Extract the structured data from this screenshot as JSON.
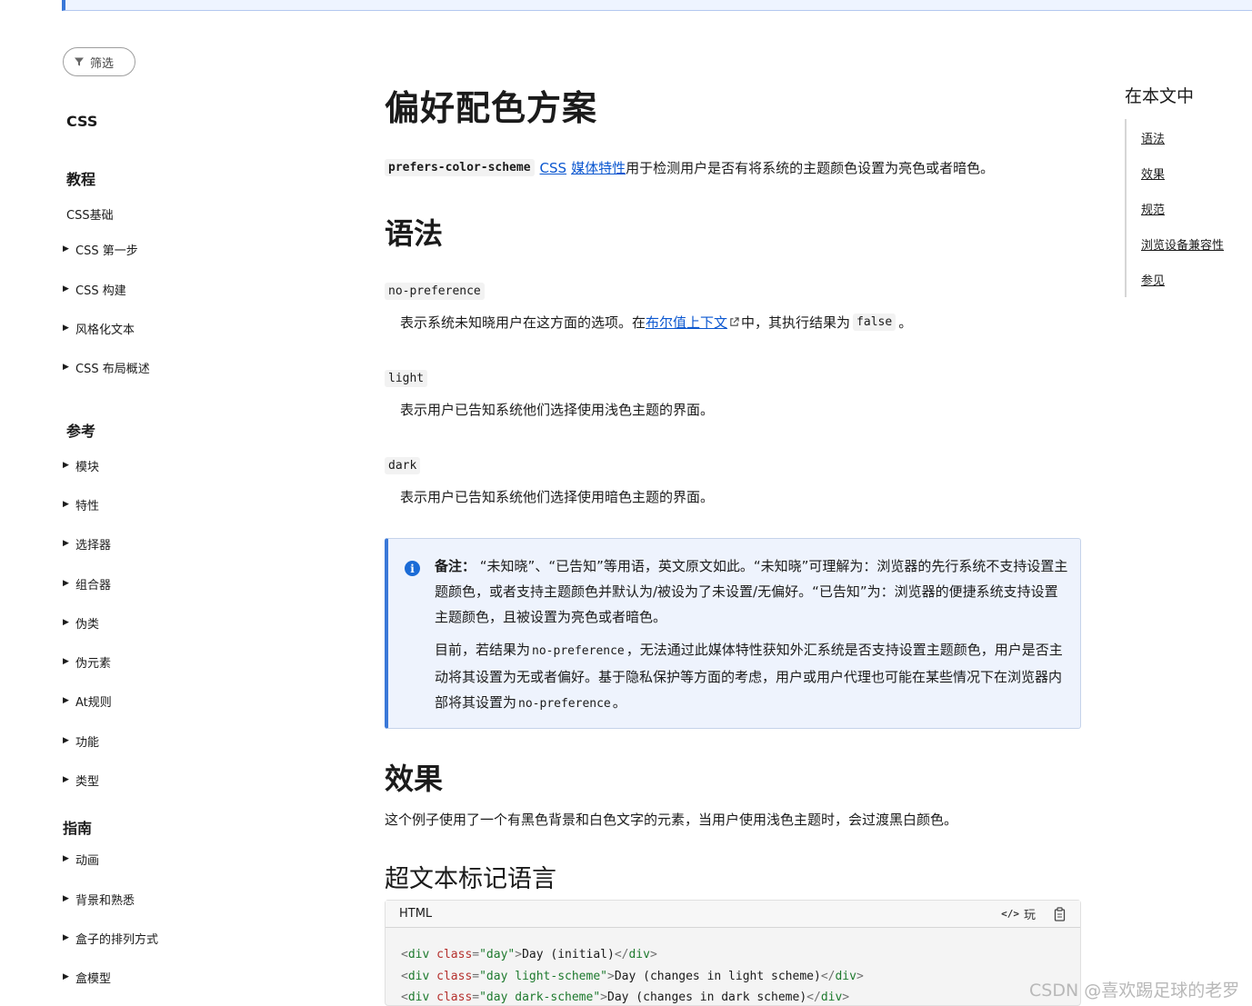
{
  "sidebar": {
    "filter_label": "筛选",
    "css_heading": "CSS",
    "tutorial_heading": "教程",
    "tutorial_basics": "CSS基础",
    "tutorial_items": [
      "CSS 第一步",
      "CSS 构建",
      "风格化文本",
      "CSS 布局概述"
    ],
    "reference_heading": "参考",
    "reference_items": [
      "模块",
      "特性",
      "选择器",
      "组合器",
      "伪类",
      "伪元素",
      "At规则",
      "功能",
      "类型"
    ],
    "guide_heading": "指南",
    "guide_items": [
      "动画",
      "背景和熟悉",
      "盒子的排列方式",
      "盒模型"
    ]
  },
  "article": {
    "title": "偏好配色方案",
    "intro": {
      "code": "prefers-color-scheme",
      "link1": "CSS",
      "link2": "媒体特性",
      "text": "用于检测用户是否有将系统的主题颜色设置为亮色或者暗色。"
    },
    "syntax_heading": "语法",
    "values": [
      {
        "term": "no-preference",
        "desc_before": "表示系统未知晓用户在这方面的选项。在",
        "link": "布尔值上下文",
        "desc_after": "中，其执行结果为",
        "code": "false",
        "end": "。"
      },
      {
        "term": "light",
        "desc": "表示用户已告知系统他们选择使用浅色主题的界面。"
      },
      {
        "term": "dark",
        "desc": "表示用户已告知系统他们选择使用暗色主题的界面。"
      }
    ],
    "note": {
      "label": "备注：",
      "para1": " “未知晓”、“已告知”等用语，英文原文如此。“未知晓”可理解为：浏览器的先行系统不支持设置主题颜色，或者支持主题颜色并默认为/被设为了未设置/无偏好。“已告知”为：浏览器的便捷系统支持设置主题颜色，且被设置为亮色或者暗色。",
      "para2_before": "目前，若结果为",
      "para2_code1": "no-preference",
      "para2_mid": "，无法通过此媒体特性获知外汇系统是否支持设置主题颜色，用户是否主动将其设置为无或者偏好。基于隐私保护等方面的考虑，用户或用户代理也可能在某些情况下在浏览器内部将其设置为",
      "para2_code2": "no-preference",
      "para2_end": "。"
    },
    "effect_heading": "效果",
    "effect_text": "这个例子使用了一个有黑色背景和白色文字的元素，当用户使用浅色主题时，会过渡黑白颜色。",
    "html_heading": "超文本标记语言",
    "code_block": {
      "lang": "HTML",
      "play_label": "玩",
      "lines": [
        {
          "cls": "day",
          "text": "Day (initial)"
        },
        {
          "cls": "day light-scheme",
          "text": "Day (changes in light scheme)"
        },
        {
          "cls": "day dark-scheme",
          "text": "Day (changes in dark scheme)"
        }
      ]
    }
  },
  "toc": {
    "title": "在本文中",
    "items": [
      "语法",
      "效果",
      "规范",
      "浏览设备兼容性",
      "参见"
    ]
  },
  "watermark": "CSDN @喜欢踢足球的老罗"
}
